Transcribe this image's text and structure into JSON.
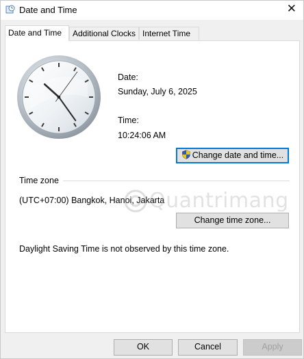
{
  "window": {
    "title": "Date and Time",
    "close_glyph": "✕"
  },
  "tabs": [
    {
      "label": "Date and Time",
      "active": true
    },
    {
      "label": "Additional Clocks",
      "active": false
    },
    {
      "label": "Internet Time",
      "active": false
    }
  ],
  "clock": {
    "hour": 10,
    "minute": 24,
    "second": 6
  },
  "date_section": {
    "date_label": "Date:",
    "date_value": "Sunday, July 6, 2025",
    "time_label": "Time:",
    "time_value": "10:24:06 AM",
    "change_button": "Change date and time...",
    "change_button_icon": "uac-shield-icon"
  },
  "timezone_section": {
    "group_label": "Time zone",
    "zone_value": "(UTC+07:00) Bangkok, Hanoi, Jakarta",
    "change_button": "Change time zone...",
    "dst_note": "Daylight Saving Time is not observed by this time zone."
  },
  "watermark": {
    "text": "Quantrimang"
  },
  "footer": {
    "ok": "OK",
    "cancel": "Cancel",
    "apply": "Apply"
  },
  "colors": {
    "accent": "#0078d7",
    "panel_bg": "#ffffff",
    "window_bg": "#f0f0f0"
  }
}
